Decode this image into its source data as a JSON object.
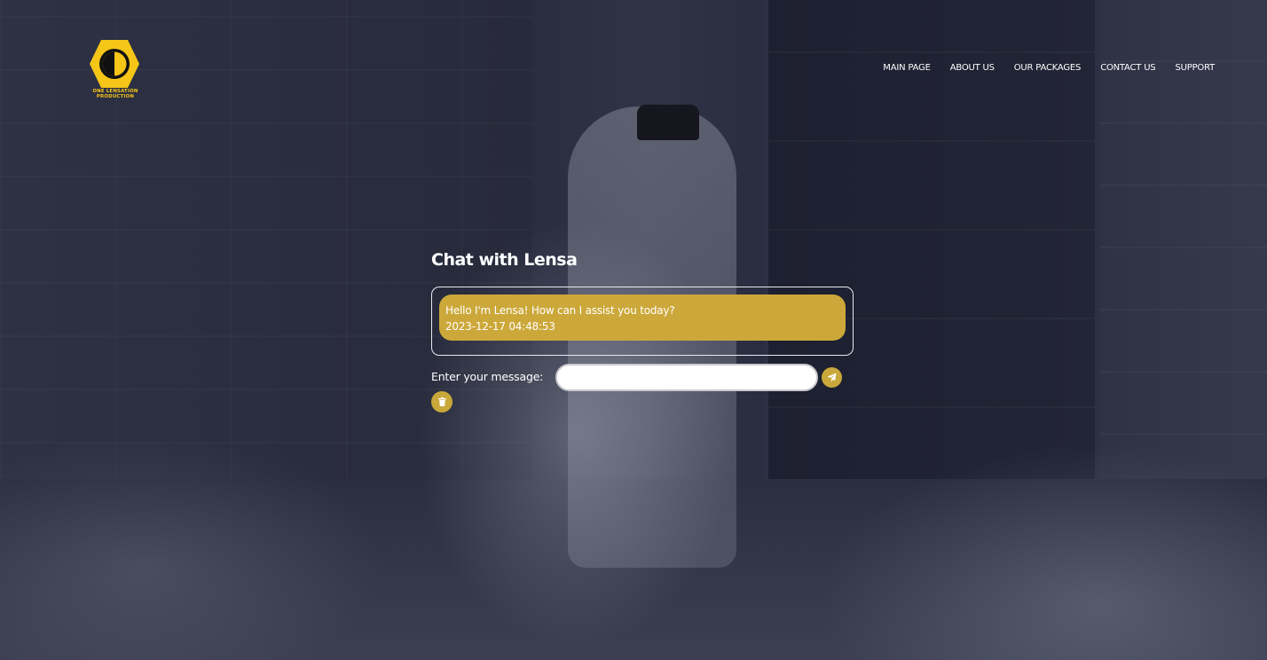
{
  "brand": {
    "logo_line1": "ONE LENSATION",
    "logo_line2": "PRODUCTION",
    "logo_color": "#f5c518"
  },
  "nav": {
    "items": [
      {
        "label": "MAIN PAGE"
      },
      {
        "label": "ABOUT US"
      },
      {
        "label": "OUR PACKAGES"
      },
      {
        "label": "CONTACT US"
      },
      {
        "label": "SUPPORT"
      }
    ]
  },
  "chat": {
    "title": "Chat with Lensa",
    "messages": [
      {
        "text": "Hello I'm Lensa! How can I assist you today?",
        "timestamp": "2023-12-17 04:48:53"
      }
    ],
    "input_label": "Enter your message:",
    "input_value": "",
    "send_icon": "paper-plane-icon",
    "clear_icon": "trash-icon",
    "accent_color": "#cca83a"
  }
}
